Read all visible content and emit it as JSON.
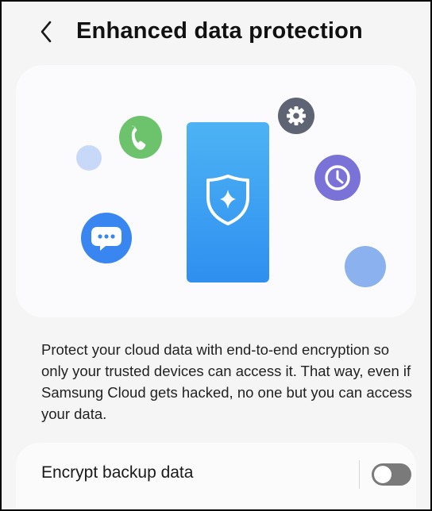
{
  "header": {
    "back_icon": "chevron-left-icon",
    "title": "Enhanced data protection"
  },
  "illustration": {
    "icons": [
      "phone-call-icon",
      "gear-icon",
      "clock-icon",
      "chat-bubble-icon",
      "shield-star-icon"
    ],
    "colors": {
      "phone_bubble": "#6cc36b",
      "gear_bubble": "#5e6473",
      "clock_bubble": "#7a72d6",
      "chat_bubble": "#3a86f0",
      "phone_device": "#3aa0f2",
      "small_dot": "#c7d8f8",
      "large_dot": "#8bb2ef"
    }
  },
  "description": "Protect your cloud data with end-to-end encryption so only your trusted devices can access it. That way, even if Samsung Cloud gets hacked, no one but you can access your data.",
  "setting": {
    "label": "Encrypt backup data",
    "toggle_on": false
  }
}
